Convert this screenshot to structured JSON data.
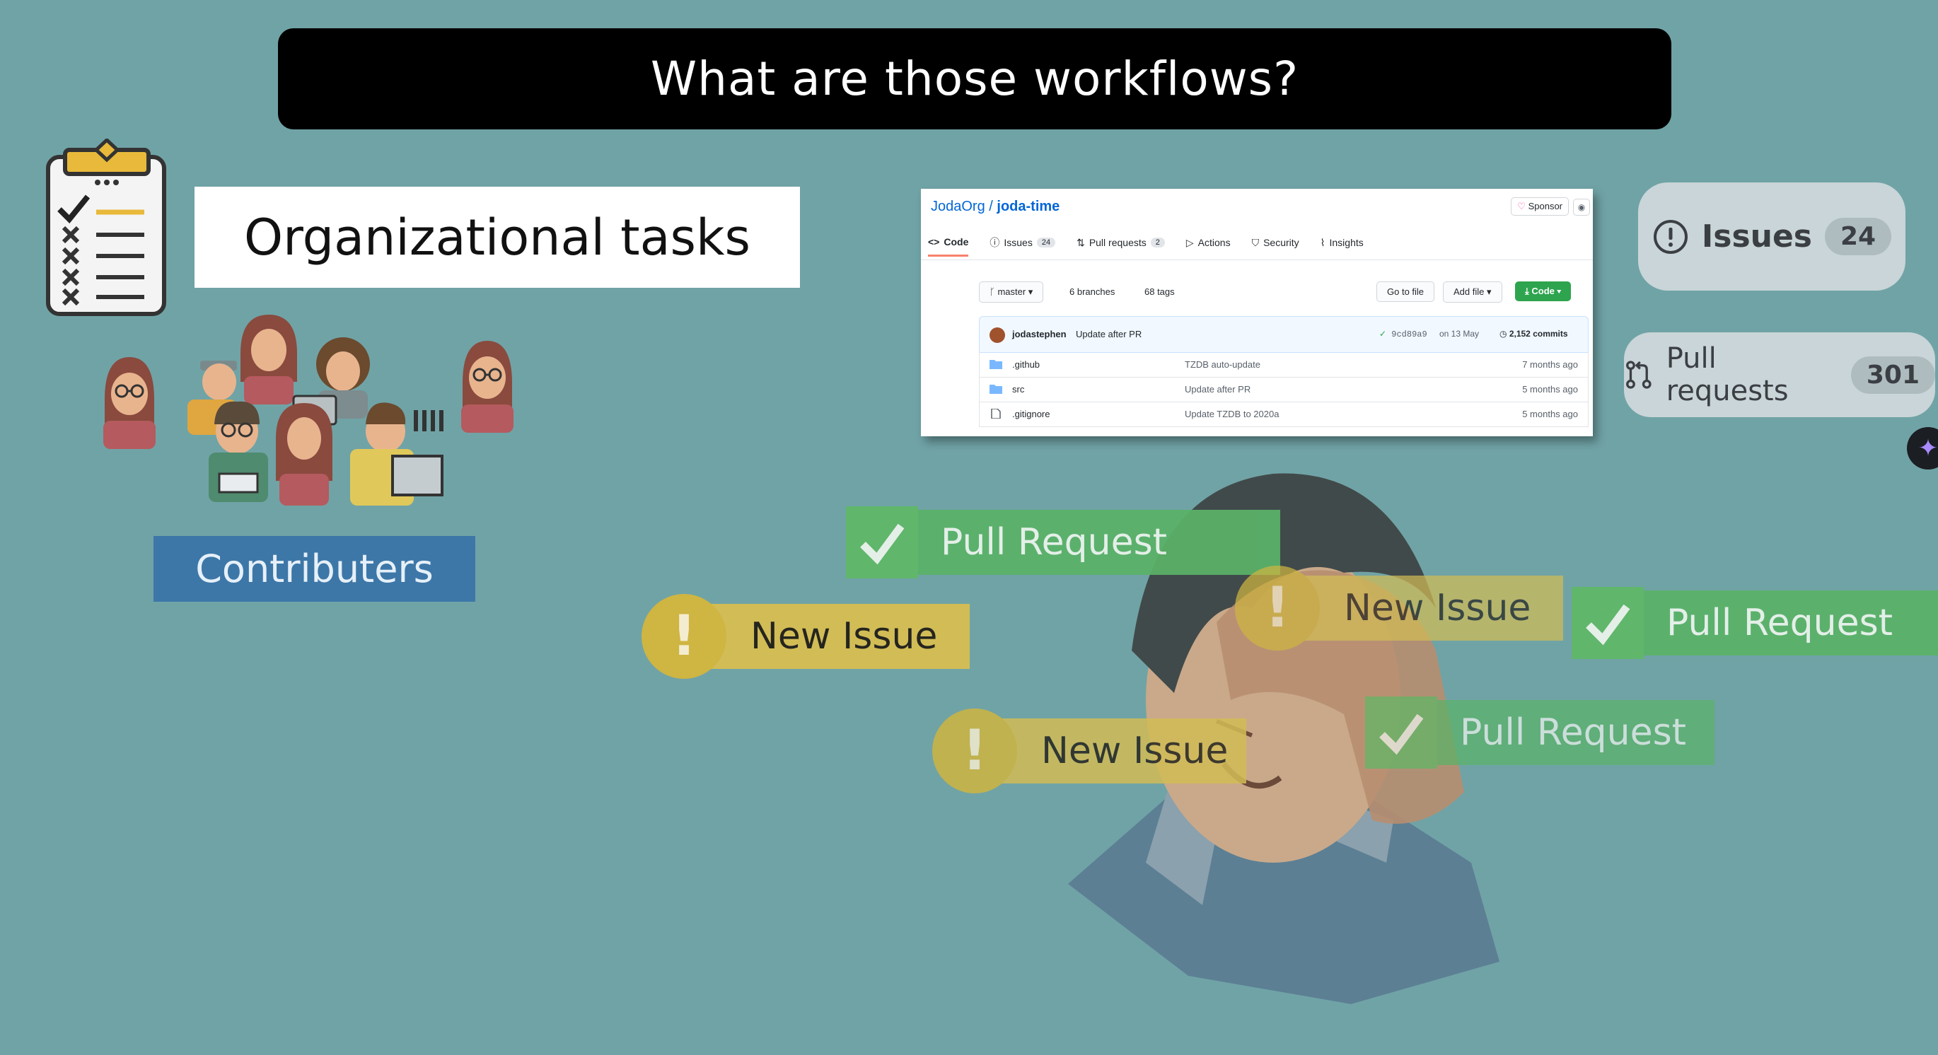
{
  "title": "What are those workflows?",
  "org_tasks": {
    "label": "Organizational tasks",
    "icon": "clipboard-checklist-icon"
  },
  "contributors": {
    "label": "Contributers"
  },
  "github": {
    "owner": "JodaOrg",
    "separator": "/",
    "repo": "joda-time",
    "sponsor": "Sponsor",
    "tabs": [
      {
        "label": "Code",
        "count": ""
      },
      {
        "label": "Issues",
        "count": "24"
      },
      {
        "label": "Pull requests",
        "count": "2"
      },
      {
        "label": "Actions",
        "count": ""
      },
      {
        "label": "Security",
        "count": ""
      },
      {
        "label": "Insights",
        "count": ""
      }
    ],
    "branch": "master",
    "branches": "6 branches",
    "tags": "68 tags",
    "go_to_file": "Go to file",
    "add_file": "Add file",
    "code_button": "Code",
    "commit": {
      "author": "jodastephen",
      "message": "Update after PR",
      "sha": "9cd89a9",
      "date": "on 13 May",
      "commits": "2,152 commits"
    },
    "files": [
      {
        "name": ".github",
        "message": "TZDB auto-update",
        "age": "7 months ago",
        "type": "folder"
      },
      {
        "name": "src",
        "message": "Update after PR",
        "age": "5 months ago",
        "type": "folder"
      },
      {
        "name": ".gitignore",
        "message": "Update TZDB to 2020a",
        "age": "5 months ago",
        "type": "file"
      }
    ]
  },
  "badges": {
    "issues": {
      "label": "Issues",
      "count": "24"
    },
    "pull_requests": {
      "label": "Pull requests",
      "count": "301"
    }
  },
  "workflow_labels": {
    "pull_request": "Pull Request",
    "new_issue": "New Issue"
  },
  "colors": {
    "background": "#70a3a6",
    "contributors": "#3d77a8",
    "pull_request": "#5ab368",
    "new_issue": "#d2bc56"
  }
}
